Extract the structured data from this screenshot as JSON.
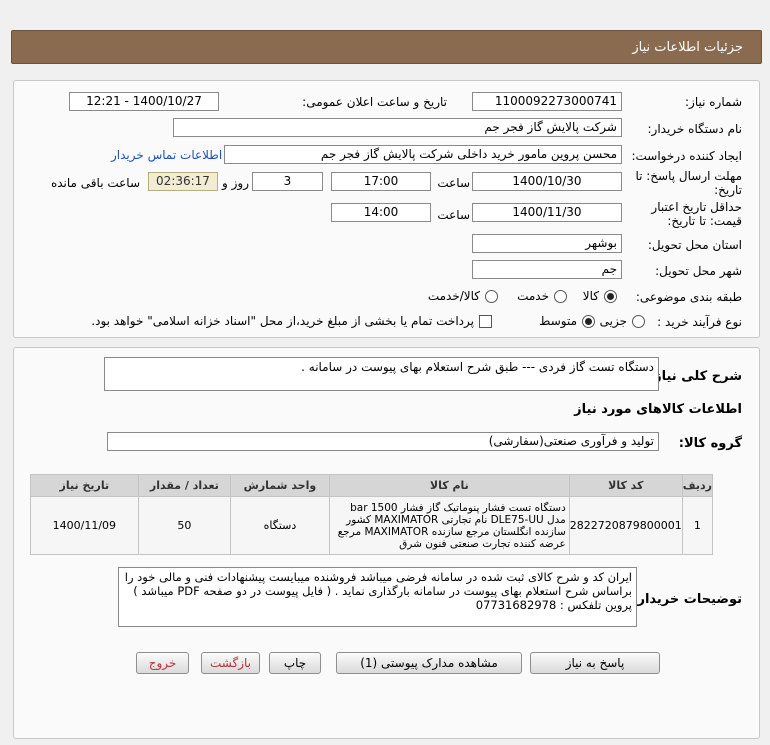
{
  "header": {
    "title": "جزئیات اطلاعات نیاز"
  },
  "form": {
    "need_number_label": "شماره نیاز:",
    "need_number": "1100092273000741",
    "announce_label": "تاریخ و ساعت اعلان عمومی:",
    "announce_value": "1400/10/27 - 12:21",
    "buyer_org_label": "نام دستگاه خریدار:",
    "buyer_org": "شرکت پالایش گاز فجر جم",
    "requester_label": "ایجاد کننده درخواست:",
    "requester": "محسن پروین مامور خرید داخلی شرکت پالایش گاز فجر جم",
    "contact_link": "اطلاعات تماس خریدار",
    "deadline_label_1": "مهلت ارسال پاسخ: تا",
    "deadline_label_2": "تاریخ:",
    "deadline_date": "1400/10/30",
    "time_label": "ساعت",
    "deadline_time": "17:00",
    "days_value": "3",
    "days_label": "روز و",
    "remaining_time": "02:36:17",
    "remaining_label": "ساعت باقی مانده",
    "validity_label_1": "حداقل تاریخ اعتبار",
    "validity_label_2": "قیمت: تا تاریخ:",
    "validity_date": "1400/11/30",
    "validity_time": "14:00",
    "province_label": "استان محل تحویل:",
    "province": "بوشهر",
    "city_label": "شهر محل تحویل:",
    "city": "جم",
    "category_label": "طبقه بندی موضوعی:",
    "category_options": [
      "کالا",
      "خدمت",
      "کالا/خدمت"
    ],
    "category_selected": "کالا",
    "process_label": "نوع فرآیند خرید :",
    "process_options": [
      "جزیی",
      "متوسط"
    ],
    "process_selected": "متوسط",
    "payment_note": "پرداخت تمام یا بخشی از مبلغ خرید،از محل \"اسناد خزانه اسلامی\" خواهد بود."
  },
  "summary": {
    "label": "شرح کلی نیاز:",
    "text": "دستگاه تست گاز فردی --- طبق شرح استعلام بهای پیوست در سامانه ."
  },
  "goods": {
    "section_title": "اطلاعات کالاهای مورد نیاز",
    "group_label": "گروه کالا:",
    "group_value": "تولید و فرآوری صنعتی(سفارشی)",
    "columns": [
      "ردیف",
      "کد کالا",
      "نام کالا",
      "واحد شمارش",
      "تعداد / مقدار",
      "تاریخ نیاز"
    ],
    "rows": [
      {
        "row": "1",
        "code": "2822720879800001",
        "name": "دستگاه تست فشار پنوماتیک گاز فشار 1500 bar مدل DLE75-UU نام تجارتی MAXIMATOR کشور سازنده انگلستان مرجع سازنده MAXIMATOR مرجع عرضه کننده تجارت صنعتی فنون شرق",
        "unit": "دستگاه",
        "qty": "50",
        "date": "1400/11/09"
      }
    ]
  },
  "buyer_notes": {
    "label": "توضیحات خریدار:",
    "line1": "ایران کد و شرح کالای ثبت شده در سامانه فرضی میباشد فروشنده میبایست پیشنهادات فنی و مالی خود را براساس شرح استعلام بهای پیوست در سامانه بارگذاری نماید . ( فایل پیوست در دو صفحه PDF میباشد )",
    "line2": "پروین    تلفکس : 07731682978"
  },
  "buttons": {
    "reply": "پاسخ به نیاز",
    "attachments": "مشاهده مدارک پیوستی (1)",
    "print": "چاپ",
    "back": "بازگشت",
    "exit": "خروج"
  }
}
